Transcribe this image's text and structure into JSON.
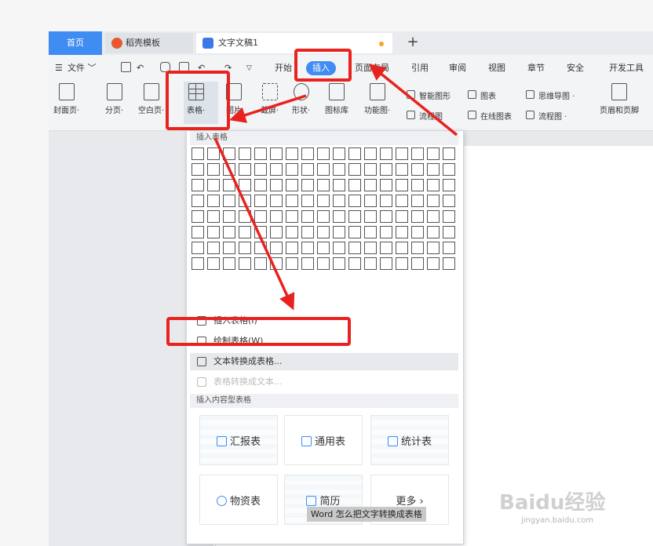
{
  "tabs": {
    "home": "首页",
    "template": "稻壳模板",
    "document": "文字文稿1",
    "add": "+"
  },
  "menu": {
    "file": "文件",
    "items": [
      "开始",
      "插入",
      "页面布局",
      "引用",
      "审阅",
      "视图",
      "章节",
      "安全",
      "开发工具"
    ]
  },
  "ribbon": {
    "cover": "封面页",
    "page_break": "分页",
    "blank_page": "空白页",
    "table": "表格",
    "picture": "图片",
    "screenshot": "截屏",
    "shape": "形状",
    "icon_lib": "图标库",
    "function_chart": "功能图",
    "smart_shape": "智能图形",
    "chart": "图表",
    "mind_map": "思维导图",
    "online_chart": "在线图表",
    "flowchart": "流程图",
    "header_footer": "页眉和页脚"
  },
  "dropdown": {
    "grid_header": "插入表格",
    "grid_cols": 17,
    "grid_rows": 8,
    "insert_table": "插入表格(I)",
    "draw_table": "绘制表格(W)",
    "text_to_table": "文本转换成表格...",
    "table_to_text": "表格转换成文本...",
    "content_header": "插入内容型表格",
    "cards": [
      "汇报表",
      "通用表",
      "统计表",
      "物资表",
      "简历",
      "更多"
    ]
  },
  "caption": "Word 怎么把文字转换成表格",
  "watermark": {
    "brand": "Baidu经验",
    "url": "jingyan.baidu.com"
  },
  "colors": {
    "accent": "#3f8cf3",
    "annotation": "#e8231f"
  }
}
